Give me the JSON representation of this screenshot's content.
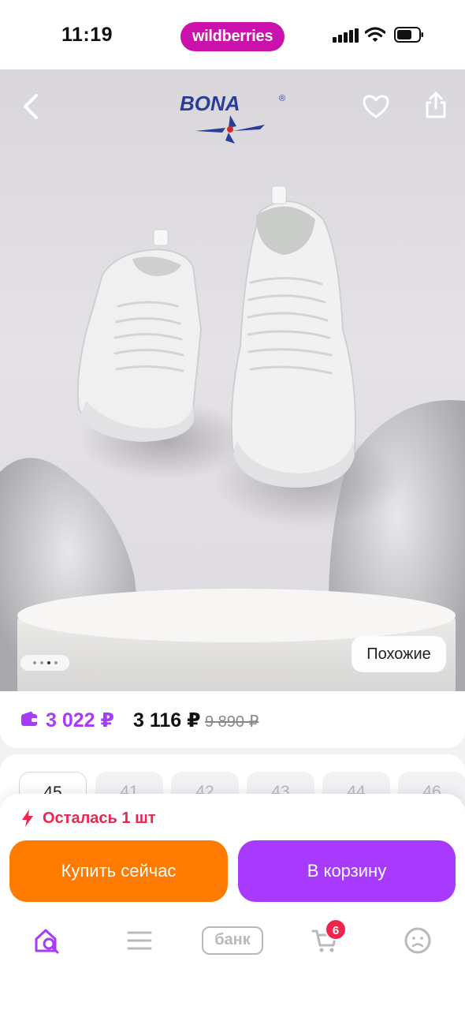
{
  "status_bar": {
    "time": "11:19",
    "app_pill": "wildberries"
  },
  "hero": {
    "brand_logo_text": "BONA",
    "registered_mark": "®",
    "similar_label": "Похожие",
    "carousel_pages": 4,
    "carousel_active": 2
  },
  "price": {
    "wallet_price": "3 022 ₽",
    "regular_price": "3 116 ₽",
    "old_price": "9 890 ₽"
  },
  "sizes": [
    "45",
    "41",
    "42",
    "43",
    "44",
    "46"
  ],
  "stock": {
    "note": "Осталась 1 шт"
  },
  "actions": {
    "buy_now": "Купить сейчас",
    "add_to_cart": "В корзину"
  },
  "tab_bar": {
    "bank_label": "банк",
    "cart_badge": "6"
  },
  "colors": {
    "brand_pink": "#cb11ab",
    "purple": "#a73afd",
    "orange": "#ff7a00",
    "alert_red": "#f0244d"
  },
  "icons": [
    "back-arrow-icon",
    "heart-icon",
    "share-icon",
    "wallet-icon",
    "lightning-icon",
    "home-search-icon",
    "menu-icon",
    "cart-icon",
    "profile-icon",
    "signal-icon",
    "wifi-icon",
    "battery-icon"
  ]
}
